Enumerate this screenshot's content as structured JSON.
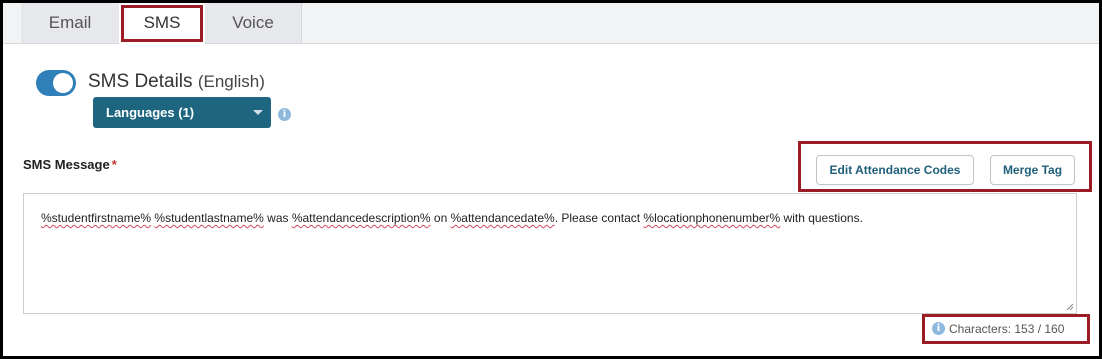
{
  "tabs": [
    {
      "label": "Email"
    },
    {
      "label": "SMS"
    },
    {
      "label": "Voice"
    }
  ],
  "details": {
    "title": "SMS Details",
    "language_note": "(English)",
    "languages_button": "Languages (1)"
  },
  "message": {
    "label": "SMS Message",
    "required_mark": "*",
    "edit_codes_button": "Edit Attendance Codes",
    "merge_tag_button": "Merge Tag",
    "parts": [
      "%studentfirstname%",
      " ",
      "%studentlastname%",
      " was ",
      "%attendancedescription%",
      " on ",
      "%attendancedate%",
      ". Please contact ",
      "%locationphonenumber%",
      " with questions."
    ],
    "counter": "Characters: 153 / 160"
  },
  "colors": {
    "accent": "#2f7fb9",
    "button_dark": "#1e6580",
    "highlight": "#9b1c25"
  },
  "icons": {
    "info": "i"
  }
}
